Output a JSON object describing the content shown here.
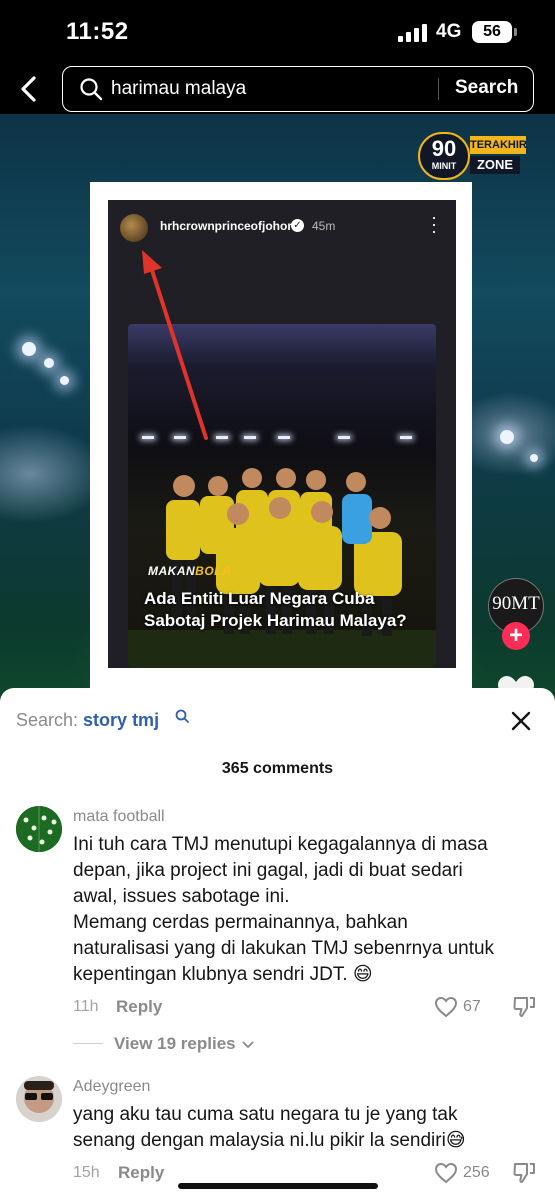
{
  "status_bar": {
    "time": "11:52",
    "network": "4G",
    "battery": "56"
  },
  "search": {
    "query": "harimau malaya",
    "button_label": "Search"
  },
  "video": {
    "channel_logo": {
      "number": "90",
      "minit": "MINIT",
      "terakhir": "TERAKHIR",
      "zone": "ZONE"
    },
    "story": {
      "username": "hrhcrownprinceofjohor",
      "time": "45m",
      "brand_part1": "MAKAN",
      "brand_part2": "BOLA",
      "headline": "Ada Entiti Luar Negara Cuba Sabotaj Projek Harimau Malaya?"
    },
    "creator_logo": "90MT"
  },
  "comments_sheet": {
    "search_prefix": "Search: ",
    "search_term": "story tmj",
    "count_label": "365 comments",
    "comments": [
      {
        "username": "mata football",
        "text_lines": [
          "Ini tuh cara TMJ menutupi kegagalannya di masa",
          "depan, jika project ini gagal, jadi di buat sedari",
          "awal, issues sabotage ini.",
          "Memang cerdas permainannya, bahkan",
          "naturalisasi yang di lakukan TMJ sebenrnya untuk",
          "kepentingan klubnya sendri JDT. 😄"
        ],
        "time": "11h",
        "reply_label": "Reply",
        "likes": "67",
        "view_replies": "View 19 replies"
      },
      {
        "username": "Adeygreen",
        "text_lines": [
          "yang aku tau cuma satu negara tu je yang tak",
          "senang dengan malaysia ni.lu pikir la sendiri😅"
        ],
        "time": "15h",
        "reply_label": "Reply",
        "likes": "256"
      }
    ]
  },
  "colors": {
    "accent_search_term": "#2f5fb3",
    "follow_plus": "#ff2c55",
    "logo_gold": "#f2b51a",
    "arrow": "#e0342a"
  }
}
